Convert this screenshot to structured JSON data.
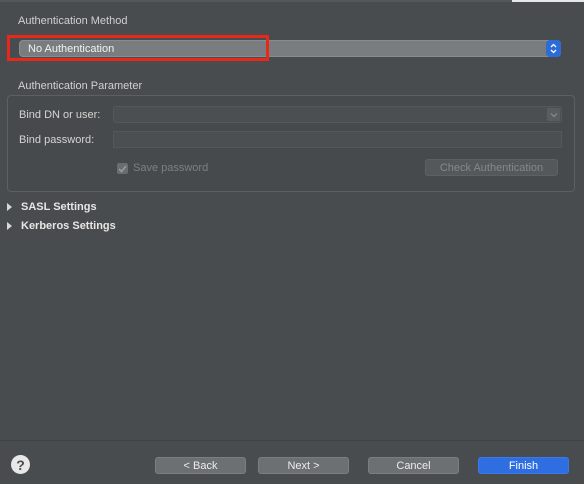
{
  "auth_method": {
    "title": "Authentication Method",
    "selected": "No Authentication",
    "stepper_icon": "up-down-chevron-icon"
  },
  "auth_params": {
    "title": "Authentication Parameter",
    "bind_dn_label": "Bind DN or user:",
    "bind_dn_value": "",
    "bind_password_label": "Bind password:",
    "bind_password_value": "",
    "save_password_label": "Save password",
    "save_password_checked": true,
    "check_button": "Check Authentication"
  },
  "sections": [
    {
      "label": "SASL Settings",
      "expanded": false
    },
    {
      "label": "Kerberos Settings",
      "expanded": false
    }
  ],
  "footer": {
    "help_icon": "question-mark-icon",
    "back": "< Back",
    "next": "Next >",
    "cancel": "Cancel",
    "finish": "Finish"
  },
  "colors": {
    "background": "#494c4e",
    "accent": "#2e6ee0",
    "highlight": "#e8281b"
  }
}
